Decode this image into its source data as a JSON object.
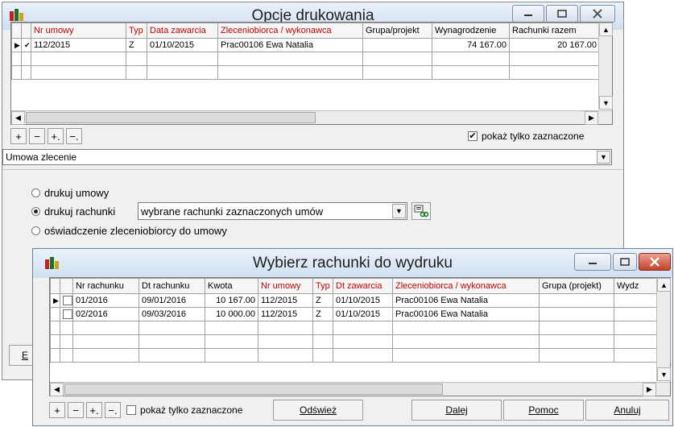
{
  "main_window": {
    "title": "Opcje drukowania",
    "columns": [
      "Nr umowy",
      "Typ",
      "Data zawarcia",
      "Zleceniobiorca / wykonawca",
      "Grupa/projekt",
      "Wynagrodzenie",
      "Rachunki razem"
    ],
    "rows": [
      {
        "nr_umowy": "112/2015",
        "typ": "Z",
        "data_zawarcia": "01/10/2015",
        "zleceniobiorca": "Prac00106 Ewa Natalia",
        "grupa": "",
        "wynagrodzenie": "74 167.00",
        "rachunki": "20 167.00"
      }
    ],
    "show_selected_label": "pokaż tylko zaznaczone",
    "contract_type": "Umowa zlecenie",
    "radio_print_contracts": "drukuj umowy",
    "radio_print_bills": "drukuj rachunki",
    "bills_option": "wybrane rachunki zaznaczonych  umów",
    "radio_statement": "oświadczenie zleceniobiorcy do umowy",
    "partial_button_letter": "E"
  },
  "dialog": {
    "title": "Wybierz rachunki do wydruku",
    "columns": [
      "Nr rachunku",
      "Dt rachunku",
      "Kwota",
      "Nr umowy",
      "Typ",
      "Dt zawarcia",
      "Zleceniobiorca / wykonawca",
      "Grupa (projekt)",
      "Wydz"
    ],
    "rows": [
      {
        "nr": "01/2016",
        "dt": "09/01/2016",
        "kwota": "10 167.00",
        "umowa": "112/2015",
        "typ": "Z",
        "dt_zawarcia": "01/10/2015",
        "zleceniobiorca": "Prac00106 Ewa Natalia",
        "grupa": "",
        "wydz": ""
      },
      {
        "nr": "02/2016",
        "dt": "09/03/2016",
        "kwota": "10 000.00",
        "umowa": "112/2015",
        "typ": "Z",
        "dt_zawarcia": "01/10/2015",
        "zleceniobiorca": "Prac00106 Ewa Natalia",
        "grupa": "",
        "wydz": ""
      }
    ],
    "show_selected_label": "pokaż tylko zaznaczone",
    "refresh_label": "Odśwież",
    "next_label": "Dalej",
    "help_label": "Pomoc",
    "cancel_label": "Anuluj"
  },
  "nav": {
    "add": "+",
    "remove": "−",
    "plus_dot": "+.",
    "minus_dot": "−."
  },
  "colors": {
    "header_highlight": "#c00000",
    "close_red": "#c4412a"
  }
}
